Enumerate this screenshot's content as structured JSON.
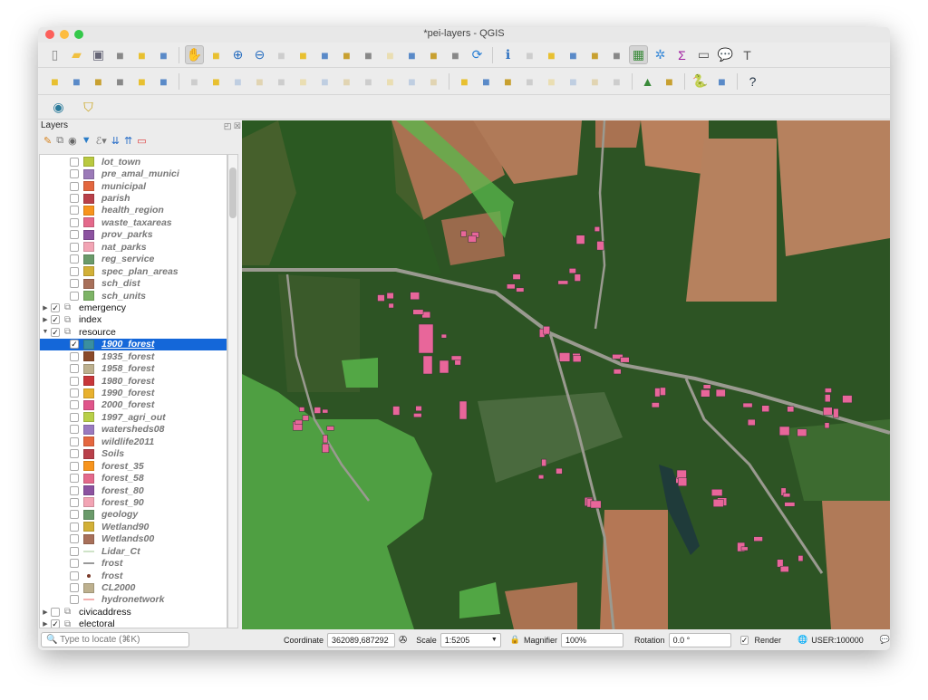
{
  "window": {
    "title": "*pei-layers - QGIS"
  },
  "toolbar1": [
    "new-project",
    "open-project",
    "save-project",
    "save-as",
    "print-layout",
    "style-manager",
    "|",
    "pan-hand",
    "pan-to-selection",
    "zoom-in",
    "zoom-out",
    "zoom-native",
    "zoom-full",
    "zoom-selection",
    "zoom-layer",
    "zoom-last",
    "zoom-next",
    "new-bookmark",
    "show-bookmarks",
    "temporal",
    "refresh",
    "|",
    "identify",
    "actions",
    "select-features",
    "select-value",
    "deselect",
    "attribute-table",
    "statistics",
    "toolbox",
    "field-calculator",
    "measure",
    "map-tips",
    "text-annotation"
  ],
  "toolbar2": [
    "data-source-manager",
    "new-geopackage",
    "new-shapefile",
    "new-spatialite",
    "new-virtual",
    "digitize-layer",
    "|",
    "current-edits",
    "toggle-editing",
    "save-edits",
    "add-feature",
    "vertex-tool",
    "merge",
    "delete-selected",
    "cut",
    "copy",
    "paste",
    "undo",
    "redo",
    "|",
    "label-tool",
    "diagram",
    "pin-label",
    "highlight-label",
    "move-label",
    "rotate-label",
    "change-label",
    "show-label",
    "|",
    "georeferencer",
    "osm-plugin",
    "|",
    "python-console",
    "mapswipe",
    "|",
    "help"
  ],
  "toolbar3": [
    "plugin-circle",
    "plugin-shield"
  ],
  "layers_panel": {
    "title": "Layers",
    "search_placeholder": "Type to locate (⌘K)",
    "rows": [
      {
        "name": "lot_town",
        "color": "#b9c940",
        "level": 1,
        "checked": false
      },
      {
        "name": "pre_amal_munici",
        "color": "#9b7ab8",
        "level": 1,
        "checked": false
      },
      {
        "name": "municipal",
        "color": "#e3673f",
        "level": 1,
        "checked": false
      },
      {
        "name": "parish",
        "color": "#b94049",
        "level": 1,
        "checked": false
      },
      {
        "name": "health_region",
        "color": "#f7941d",
        "level": 1,
        "checked": false
      },
      {
        "name": "waste_taxareas",
        "color": "#e4698b",
        "level": 1,
        "checked": false
      },
      {
        "name": "prov_parks",
        "color": "#8c52a0",
        "level": 1,
        "checked": false
      },
      {
        "name": "nat_parks",
        "color": "#f2a4b4",
        "level": 1,
        "checked": false
      },
      {
        "name": "reg_service",
        "color": "#6a9a6a",
        "level": 1,
        "checked": false
      },
      {
        "name": "spec_plan_areas",
        "color": "#d2b037",
        "level": 1,
        "checked": false
      },
      {
        "name": "sch_dist",
        "color": "#a8705a",
        "level": 1,
        "checked": false
      },
      {
        "name": "sch_units",
        "color": "#7db466",
        "level": 1,
        "checked": false
      },
      {
        "name": "emergency",
        "group": true,
        "expanded": false,
        "checked": true
      },
      {
        "name": "index",
        "group": true,
        "expanded": false,
        "checked": true
      },
      {
        "name": "resource",
        "group": true,
        "expanded": true,
        "checked": true
      },
      {
        "name": "1900_forest",
        "color": "#3a8fa0",
        "level": 1,
        "checked": true,
        "selected": true
      },
      {
        "name": "1935_forest",
        "color": "#8a4a2a",
        "level": 1,
        "checked": false
      },
      {
        "name": "1958_forest",
        "color": "#bdb08e",
        "level": 1,
        "checked": false
      },
      {
        "name": "1980_forest",
        "color": "#c8373a",
        "level": 1,
        "checked": false
      },
      {
        "name": "1990_forest",
        "color": "#e8b12e",
        "level": 1,
        "checked": false
      },
      {
        "name": "2000_forest",
        "color": "#e0548a",
        "level": 1,
        "checked": false
      },
      {
        "name": "1997_agri_out",
        "color": "#b8cf48",
        "level": 1,
        "checked": false
      },
      {
        "name": "watersheds08",
        "color": "#9a7abf",
        "level": 1,
        "checked": false
      },
      {
        "name": "wildlife2011",
        "color": "#e5673f",
        "level": 1,
        "checked": false
      },
      {
        "name": "Soils",
        "color": "#b9404a",
        "level": 1,
        "checked": false
      },
      {
        "name": "forest_35",
        "color": "#f7941d",
        "level": 1,
        "checked": false
      },
      {
        "name": "forest_58",
        "color": "#e4698b",
        "level": 1,
        "checked": false
      },
      {
        "name": "forest_80",
        "color": "#8c52a0",
        "level": 1,
        "checked": false
      },
      {
        "name": "forest_90",
        "color": "#f2a4b4",
        "level": 1,
        "checked": false
      },
      {
        "name": "geology",
        "color": "#6a9a6a",
        "level": 1,
        "checked": false
      },
      {
        "name": "Wetland90",
        "color": "#d2b037",
        "level": 1,
        "checked": false
      },
      {
        "name": "Wetlands00",
        "color": "#a8705a",
        "level": 1,
        "checked": false
      },
      {
        "name": "Lidar_Ct",
        "symbol": "line",
        "color": "#cfe3c8",
        "level": 1,
        "checked": false
      },
      {
        "name": "frost",
        "symbol": "line",
        "color": "#999999",
        "level": 1,
        "checked": false
      },
      {
        "name": "frost",
        "symbol": "point",
        "color": "#7a3a2a",
        "level": 1,
        "checked": false
      },
      {
        "name": "CL2000",
        "color": "#bdb08e",
        "level": 1,
        "checked": false
      },
      {
        "name": "hydronetwork",
        "symbol": "line",
        "color": "#f2b0b0",
        "level": 1,
        "checked": false
      },
      {
        "name": "civicaddress",
        "group": true,
        "expanded": false,
        "checked": false
      },
      {
        "name": "electoral",
        "group": true,
        "expanded": false,
        "checked": true
      }
    ]
  },
  "status": {
    "coordinate_label": "Coordinate",
    "coordinate": "362089,687292",
    "scale_label": "Scale",
    "scale": "1:5205",
    "magnifier_label": "Magnifier",
    "magnifier": "100%",
    "rotation_label": "Rotation",
    "rotation": "0.0 °",
    "render_label": "Render",
    "render_checked": true,
    "crs": "USER:100000"
  }
}
